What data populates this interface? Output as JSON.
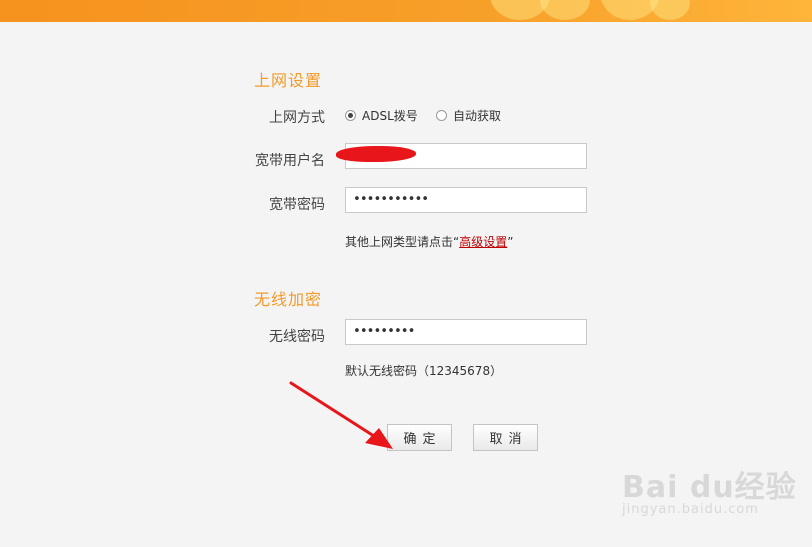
{
  "internet_settings": {
    "title": "上网设置",
    "mode_label": "上网方式",
    "modes": [
      {
        "label": "ADSL拨号",
        "checked": true
      },
      {
        "label": "自动获取",
        "checked": false
      }
    ],
    "username_label": "宽带用户名",
    "password_label": "宽带密码",
    "password_value": "•••••••••••",
    "hint_prefix": "其他上网类型请点击“",
    "hint_link": "高级设置",
    "hint_suffix": "”"
  },
  "wireless": {
    "title": "无线加密",
    "password_label": "无线密码",
    "password_value": "•••••••••",
    "default_note": "默认无线密码（12345678）"
  },
  "buttons": {
    "confirm": "确定",
    "cancel": "取消"
  },
  "watermark": {
    "brand": "Bai du经验",
    "url": "jingyan.baidu.com"
  },
  "colors": {
    "accent": "#f39a2b",
    "banner": "#f6921e",
    "link": "#c00000",
    "annotation": "#e8161a"
  }
}
